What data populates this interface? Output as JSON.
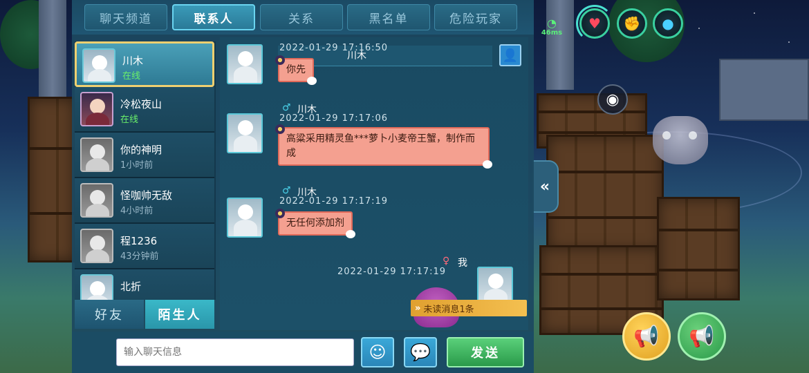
{
  "hud": {
    "latency": "46ms",
    "icons": [
      "heart-icon",
      "muscle-arm-icon",
      "water-drop-icon"
    ],
    "view_toggle_icon": "eye-icon",
    "collapse_icon": "double-chevron-left-icon",
    "speaker_icons": [
      "gold-megaphone-icon",
      "green-megaphone-icon"
    ]
  },
  "tabs": [
    {
      "label": "聊天频道",
      "active": false
    },
    {
      "label": "联系人",
      "active": true
    },
    {
      "label": "关系",
      "active": false
    },
    {
      "label": "黑名单",
      "active": false
    },
    {
      "label": "危险玩家",
      "active": false
    }
  ],
  "contacts": [
    {
      "name": "川木",
      "status": "在线",
      "online": true,
      "selected": true
    },
    {
      "name": "冷松夜山",
      "status": "在线",
      "online": true,
      "selected": false
    },
    {
      "name": "你的神明",
      "status": "1小时前",
      "online": false,
      "selected": false
    },
    {
      "name": "怪咖帅无敌",
      "status": "4小时前",
      "online": false,
      "selected": false
    },
    {
      "name": "程1236",
      "status": "43分钟前",
      "online": false,
      "selected": false
    },
    {
      "name": "北折",
      "status": "",
      "online": false,
      "selected": false
    }
  ],
  "subtabs": [
    {
      "label": "好友",
      "active": false
    },
    {
      "label": "陌生人",
      "active": true
    }
  ],
  "chat": {
    "header_name": "川木",
    "messages": [
      {
        "sender": "川木",
        "time": "2022-01-29  17:16:50",
        "text": "你先",
        "mine": false
      },
      {
        "sender": "川木",
        "time": "2022-01-29  17:17:06",
        "text": "高粱采用精灵鱼***萝卜小麦帝王蟹，制作而成",
        "mine": false
      },
      {
        "sender": "川木",
        "time": "2022-01-29  17:17:19",
        "text": "无任何添加剂",
        "mine": false
      },
      {
        "sender": "我",
        "time": "2022-01-29  17:17:19",
        "text": "",
        "mine": true
      }
    ],
    "unread_notice": "未读消息1条"
  },
  "input": {
    "placeholder": "输入聊天信息",
    "value": "",
    "emoji_icon": "smiley-icon",
    "chat_icon": "speech-bubble-icon",
    "send_label": "发送"
  },
  "colors": {
    "online": "#6af06a",
    "bubble": "#f4a090",
    "send": "#3ab85a",
    "selected_border": "#f0d070"
  }
}
